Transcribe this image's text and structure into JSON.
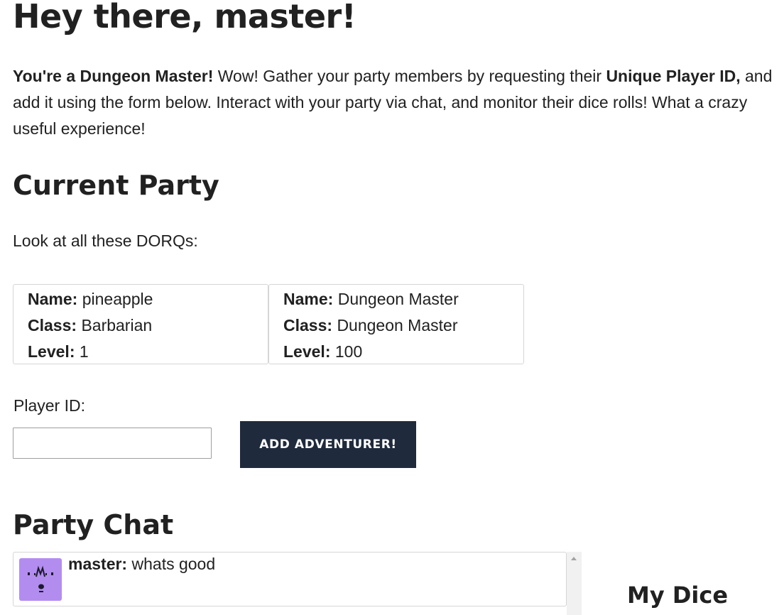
{
  "page_title": "Hey there, master!",
  "intro": {
    "bold1": "You're a Dungeon Master!",
    "text1": " Wow! Gather your party members by requesting their ",
    "bold2": "Unique Player ID,",
    "text2": " and add it using the form below. Interact with your party via chat, and monitor their dice rolls! What a crazy useful experience!"
  },
  "party": {
    "heading": "Current Party",
    "subtitle": "Look at all these DORQs:",
    "labels": {
      "name": "Name:",
      "class": "Class:",
      "level": "Level:"
    },
    "members": [
      {
        "name": "pineapple",
        "class": "Barbarian",
        "level": "1"
      },
      {
        "name": "Dungeon Master",
        "class": "Dungeon Master",
        "level": "100"
      }
    ]
  },
  "form": {
    "label": "Player ID:",
    "value": "",
    "button": "ADD ADVENTURER!"
  },
  "chat": {
    "heading": "Party Chat",
    "messages": [
      {
        "user": "master:",
        "text": " whats good",
        "avatar": "pixel-avatar-icon"
      }
    ]
  },
  "dice": {
    "heading": "My Dice"
  },
  "colors": {
    "button_bg": "#1f2a3c",
    "avatar_bg": "#b38cf0",
    "text": "#212121"
  }
}
